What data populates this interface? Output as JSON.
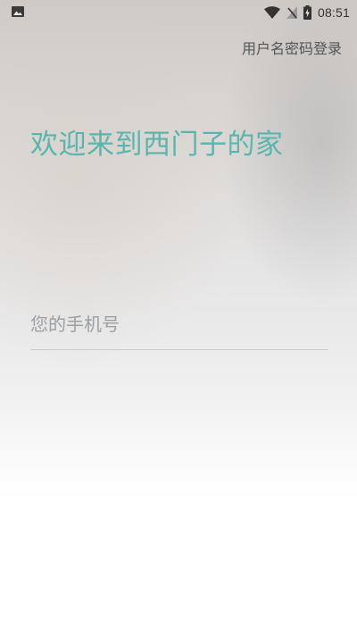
{
  "status_bar": {
    "time": "08:51",
    "icons": [
      "image-notification-icon",
      "wifi-icon",
      "no-signal-icon",
      "battery-charging-icon"
    ]
  },
  "header": {
    "login_mode_link": "用户名密码登录"
  },
  "main": {
    "welcome_title": "欢迎来到西门子的家",
    "phone_field": {
      "placeholder": "您的手机号",
      "value": ""
    }
  },
  "colors": {
    "accent": "#59b5ad",
    "link_text": "#555555",
    "placeholder": "#9aa0a3"
  }
}
